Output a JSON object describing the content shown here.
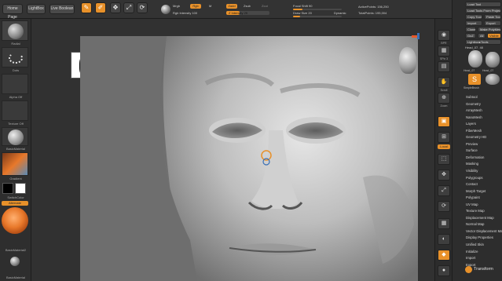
{
  "topbar": {
    "home_page": "Home Page",
    "lightbox": "LightBox",
    "live_boolean": "Live Boolean",
    "tools": [
      "Edit",
      "Draw",
      "Move",
      "Scale",
      "Rotate"
    ],
    "mrgb": "Mrgb",
    "rgb": "Rgb",
    "m": "M",
    "zadd": "Zadd",
    "zsub": "Zsub",
    "zcut": "Zcut",
    "rgb_intensity": "Rgb Intensity 100",
    "z_intensity": "Z Intensity 29",
    "focal_shift": "Focal Shift 90",
    "draw_size": "Draw Size 20",
    "dynamic": "Dynamic",
    "active_points": "ActivePoints: 156,250",
    "total_points": "TotalPoints: 195,004"
  },
  "leftpanel": {
    "brush_label": "Radial",
    "stroke_label": "Dots",
    "alpha_label": "Alpha Off",
    "texture_label": "Texture Off",
    "material_label": "BasicMaterial",
    "gradient_label": "Gradient",
    "switchcolor_label": "SwitchColor",
    "alternate_label": "Alternate",
    "basic_material2": "BasicMaterial2",
    "basic_material": "BasicMaterial"
  },
  "rstrip": {
    "labels": [
      "BPR",
      "SPix 3",
      "",
      "Scroll",
      "Zoom",
      "Actual",
      "AAHalf",
      "Persp",
      "Floor",
      "Local",
      "Gxyz",
      "Frame",
      "Move",
      "Scale",
      "Rotate",
      "Transp",
      "Solo",
      "Dynamic"
    ]
  },
  "rpanel": {
    "top_buttons": [
      "Load Tool",
      "Save As",
      "Load Tools From Project",
      "Copy Tool",
      "Paste Tool",
      "Import",
      "Export",
      "Clone",
      "Make PolyMesh3D",
      "GoZ",
      "All",
      "Visible",
      "R"
    ],
    "lightbox_tools": "Lightbox▸Tools",
    "head_label": "Head_07. 48",
    "thumb_labels": [
      "Head_07",
      "Head_07",
      "SimpleBrush",
      "Head_07"
    ],
    "menu": [
      "Subtool",
      "Geometry",
      "ArrayMesh",
      "NanoMesh",
      "Layers",
      "FiberMesh",
      "Geometry HD",
      "Preview",
      "Surface",
      "Deformation",
      "Masking",
      "Visibility",
      "Polygroups",
      "Contact",
      "Morph Target",
      "Polypaint",
      "UV Map",
      "Texture Map",
      "Displacement Map",
      "Normal Map",
      "Vector Displacement Map",
      "Display Properties",
      "Unified Skin",
      "Initialize",
      "Import",
      "Export"
    ],
    "transform": "Transform"
  }
}
